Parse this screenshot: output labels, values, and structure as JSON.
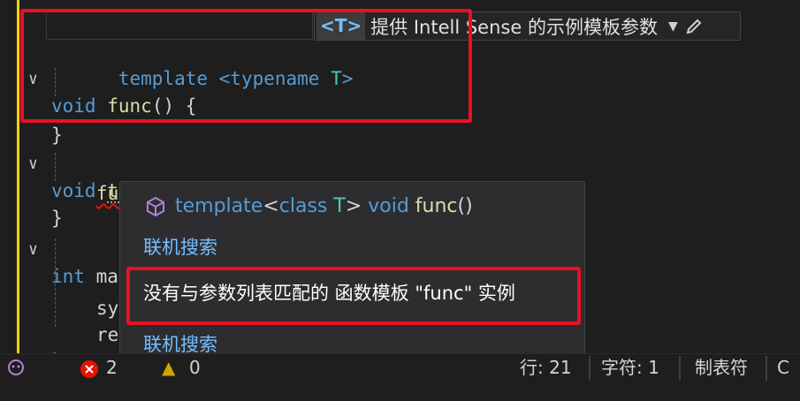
{
  "editor": {
    "lines": [
      {
        "tokens": [
          "template",
          " <typename ",
          "T",
          ">"
        ]
      },
      {
        "kw": "void",
        "fn": "func",
        "rest": "() {"
      },
      {
        "text": "}"
      },
      {
        "kw": "void",
        "fn": "test02",
        "rest": "() {"
      },
      {
        "fn": "func",
        "rest": "()"
      },
      {
        "text": "}"
      },
      {
        "kw": "int",
        "name": "ma"
      },
      {
        "text": "sy"
      },
      {
        "text": "re"
      },
      {
        "text": "}"
      }
    ]
  },
  "template_bar": {
    "badge": "<T>",
    "text": "提供 Intell Sense 的示例模板参数",
    "dropdown_icon": "chevron-down-icon",
    "edit_icon": "pencil-icon"
  },
  "popup": {
    "signature": {
      "template": "template",
      "open": "<",
      "class_kw": "class",
      "T": " T",
      "close": ">",
      "void": " void ",
      "func": "func",
      "parens": "()"
    },
    "link1": "联机搜索",
    "error": "没有与参数列表匹配的 函数模板 \"func\" 实例",
    "link2": "联机搜索"
  },
  "status": {
    "errors": "2",
    "warnings": "0",
    "line": "行: 21",
    "col": "字符: 1",
    "tabs": "制表符",
    "extra": "C"
  },
  "colors": {
    "keyword": "#569cd6",
    "function": "#dcdcaa",
    "type": "#4ec9b0",
    "link": "#75bfff",
    "highlight_box": "#e81123"
  }
}
